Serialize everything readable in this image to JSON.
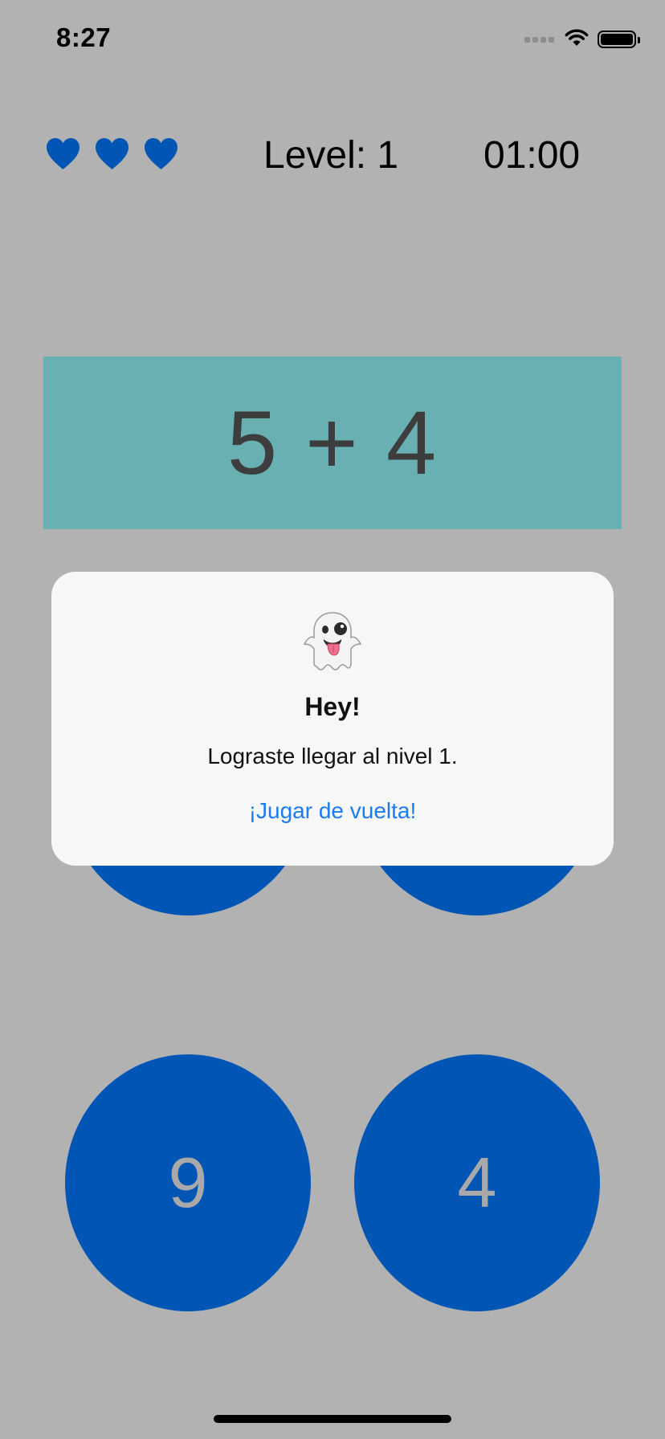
{
  "status_bar": {
    "time": "8:27"
  },
  "hud": {
    "lives": 3,
    "level_label": "Level: 1",
    "timer": "01:00"
  },
  "question": {
    "text": "5 + 4"
  },
  "answers": [
    "9",
    "4"
  ],
  "alert": {
    "emoji_icon": "ghost-icon",
    "title": "Hey!",
    "message": "Lograste llegar al nivel 1.",
    "button_label": "¡Jugar de vuelta!"
  },
  "colors": {
    "background": "#b2b2b2",
    "heart": "#0055b5",
    "question_bg": "#69b0b2",
    "answer_bg": "#0055b5",
    "answer_text": "#a9a9a9",
    "alert_bg": "#f7f7f7",
    "alert_button": "#1a7cf0"
  }
}
